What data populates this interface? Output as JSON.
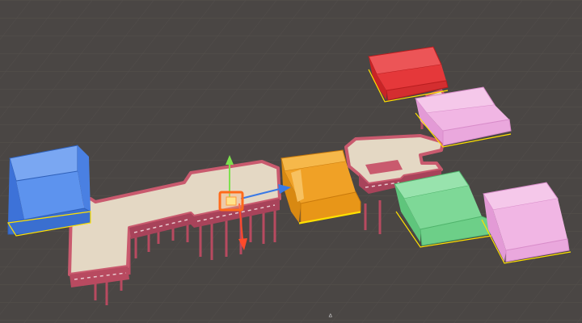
{
  "scene": {
    "view": "scene-view",
    "background": "#4a4644",
    "grid_color": "#57524f",
    "rooms": [
      {
        "name": "blue-room",
        "color": "#4f86e6",
        "dark": "#2e5fb8",
        "selected": true
      },
      {
        "name": "orange-room",
        "color": "#f0a126",
        "dark": "#c97a0c",
        "selected": true
      },
      {
        "name": "red-room",
        "color": "#e5383a",
        "dark": "#b81d1f",
        "selected": true
      },
      {
        "name": "pink-room-upper",
        "color": "#f1b6e4",
        "dark": "#d88cc9",
        "selected": true
      },
      {
        "name": "green-room",
        "color": "#7ed897",
        "dark": "#4fb36b",
        "selected": true
      },
      {
        "name": "pink-room-lower",
        "color": "#f1b6e4",
        "dark": "#d88cc9",
        "selected": true
      }
    ],
    "corridor": {
      "floor": "#e4d8c4",
      "wall": "#c95a6e",
      "wall_dark": "#a8435a"
    },
    "selection_color": "#ffe100",
    "gizmo": {
      "x_axis_color": "#ff4a2a",
      "y_axis_color": "#7ee04e",
      "z_axis_color": "#3a7ae6",
      "handle_color": "#ff6a1a"
    }
  }
}
